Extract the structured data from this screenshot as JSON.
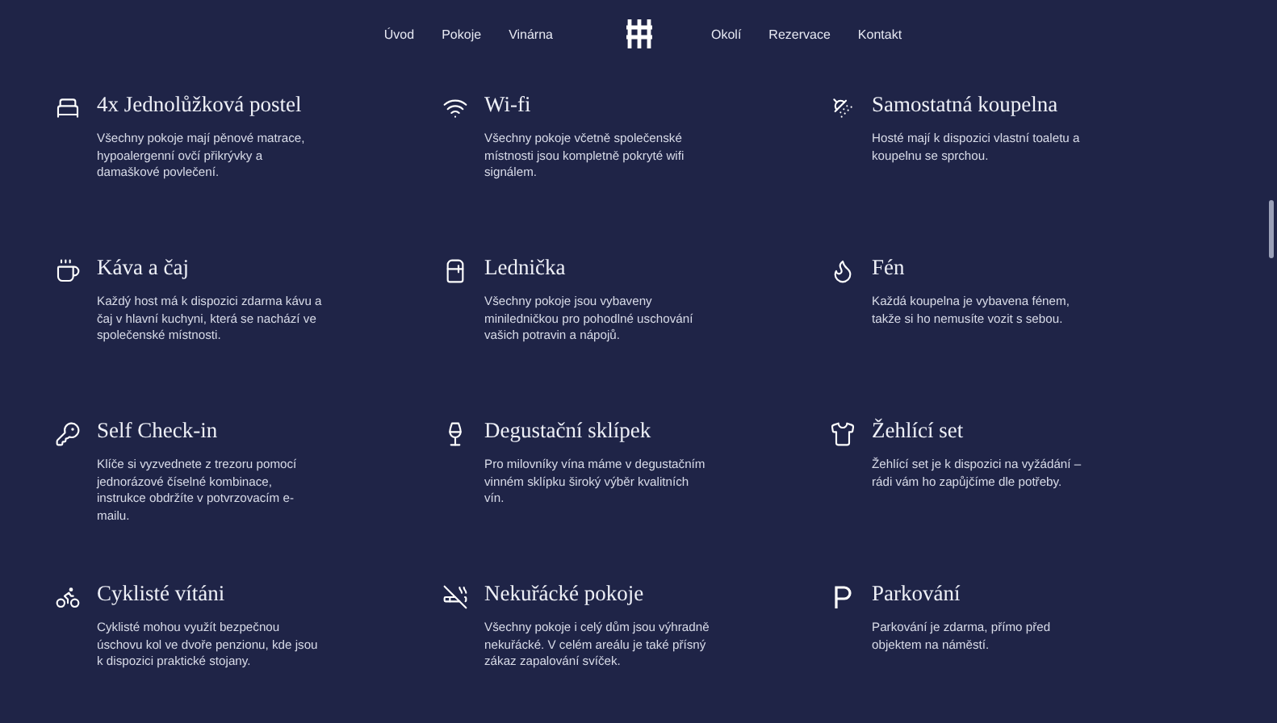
{
  "nav": {
    "left": [
      "Úvod",
      "Pokoje",
      "Vinárna"
    ],
    "right": [
      "Okolí",
      "Rezervace",
      "Kontakt"
    ]
  },
  "features": [
    {
      "title": "4x Jednolůžková postel",
      "text": "Všechny pokoje mají pěnové matrace, hypoalergenní ovčí přikrývky a damaškové povlečení."
    },
    {
      "title": "Wi-fi",
      "text": "Všechny pokoje včetně společenské místnosti jsou kompletně pokryté wifi signálem."
    },
    {
      "title": "Samostatná koupelna",
      "text": "Hosté mají k dispozici vlastní toaletu a koupelnu se sprchou."
    },
    {
      "title": "Káva a čaj",
      "text": "Každý host má k dispozici zdarma kávu a čaj v hlavní kuchyni, která se nachází ve společenské místnosti."
    },
    {
      "title": "Lednička",
      "text": "Všechny pokoje jsou vybaveny miniledničkou pro pohodlné uschování vašich potravin a nápojů."
    },
    {
      "title": "Fén",
      "text": "Každá koupelna je vybavena fénem, takže si ho nemusíte vozit s sebou."
    },
    {
      "title": "Self Check-in",
      "text": "Klíče si vyzvednete z trezoru pomocí jednorázové číselné kombinace, instrukce obdržíte v potvrzovacím e-mailu."
    },
    {
      "title": "Degustační sklípek",
      "text": "Pro milovníky vína máme v degustačním vinném sklípku široký výběr kvalitních vín."
    },
    {
      "title": "Žehlící set",
      "text": "Žehlící set je k dispozici na vyžádání – rádi vám ho zapůjčíme dle potřeby."
    },
    {
      "title": "Cyklisté vítáni",
      "text": "Cyklisté mohou využít bezpečnou úschovu kol ve dvoře penzionu, kde jsou k dispozici praktické stojany."
    },
    {
      "title": "Nekuřácké pokoje",
      "text": "Všechny pokoje i celý dům jsou výhradně nekuřácké. V celém areálu je také přísný zákaz zapalování svíček."
    },
    {
      "title": "Parkování",
      "text": "Parkování je zdarma, přímo před objektem na náměstí."
    }
  ]
}
